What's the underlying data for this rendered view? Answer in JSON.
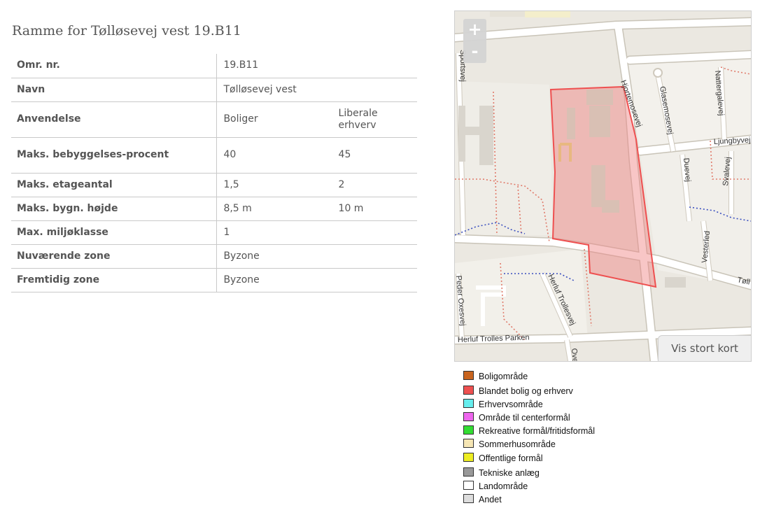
{
  "page": {
    "title": "Ramme for Tølløsevej vest 19.B11"
  },
  "table": {
    "rows": [
      {
        "key": "Omr. nr.",
        "v1": "19.B11",
        "v2": ""
      },
      {
        "key": "Navn",
        "v1": "Tølløsevej vest",
        "v2": ""
      },
      {
        "key": "Anvendelse",
        "v1": "Boliger",
        "v2": "Liberale erhverv"
      },
      {
        "key": "Maks. bebyggelses-procent",
        "v1": "40",
        "v2": "45"
      },
      {
        "key": "Maks. etageantal",
        "v1": "1,5",
        "v2": "2"
      },
      {
        "key": "Maks. bygn. højde",
        "v1": "8,5 m",
        "v2": "10 m"
      },
      {
        "key": "Max. miljøklasse",
        "v1": "1",
        "v2": ""
      },
      {
        "key": "Nuværende zone",
        "v1": "Byzone",
        "v2": ""
      },
      {
        "key": "Fremtidig zone",
        "v1": "Byzone",
        "v2": ""
      }
    ]
  },
  "map": {
    "zoom_in": "+",
    "zoom_out": "-",
    "open_large_map": "Vis stort kort",
    "streets": {
      "sportsvej": "Sportsvej",
      "hjortemosevej": "Hjortemosevej",
      "glasemosevej": "Glasemosevej",
      "nattergalevej": "Nattergalevej",
      "ljungbyvej": "Ljungbyvej",
      "duevej": "Duevej",
      "svalevej": "Svalevej",
      "vesterled": "Vesterled",
      "tollosevej": "Tøll",
      "herluf_trollesvej": "Herluf Trollesvej",
      "herluf_trolles_parken": "Herluf Trolles Parken",
      "peder_oxesvej": "Peder Oxesvej",
      "ove": "Ove"
    },
    "zone_color": "#f08080"
  },
  "legend": [
    {
      "label": "Boligområde",
      "color": "#c8641e"
    },
    {
      "label": "Blandet bolig og erhverv",
      "color": "#ee5050"
    },
    {
      "label": "Erhvervsområde",
      "color": "#66eeee"
    },
    {
      "label": "Område til centerformål",
      "color": "#ee66ee"
    },
    {
      "label": "Rekreative formål/fritidsformål",
      "color": "#33dd33"
    },
    {
      "label": "Sommerhusområde",
      "color": "#f6e6b4"
    },
    {
      "label": "Offentlige formål",
      "color": "#eeee22"
    },
    {
      "label": "Tekniske anlæg",
      "color": "#999999"
    },
    {
      "label": "Landområde",
      "color": "#ffffff"
    },
    {
      "label": "Andet",
      "color": "#dddddd"
    }
  ]
}
